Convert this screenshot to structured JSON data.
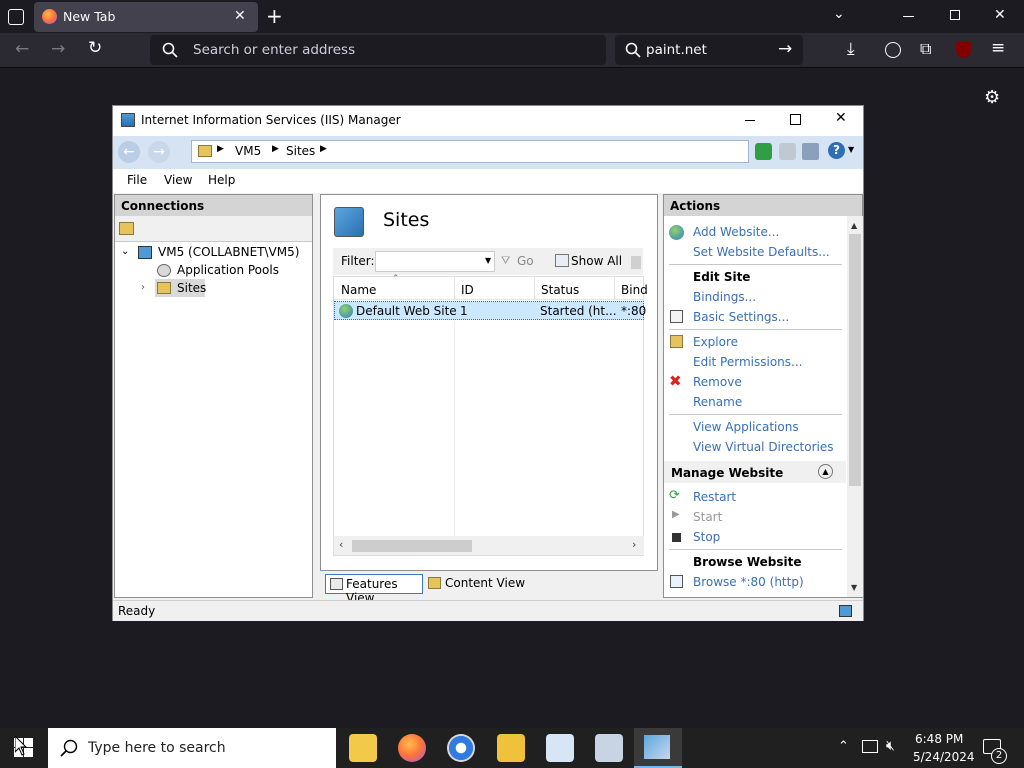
{
  "browser": {
    "tab_title": "New Tab",
    "address_placeholder": "Search or enter address",
    "search_value": "paint.net"
  },
  "iis": {
    "title": "Internet Information Services (IIS) Manager",
    "breadcrumb": [
      "VM5",
      "Sites"
    ],
    "menu": [
      "File",
      "View",
      "Help"
    ],
    "connections": {
      "header": "Connections",
      "tree": [
        {
          "label": "VM5 (COLLABNET\\VM5)"
        },
        {
          "label": "Application Pools"
        },
        {
          "label": "Sites"
        }
      ]
    },
    "sites": {
      "title": "Sites",
      "filter_label": "Filter:",
      "go_label": "Go",
      "show_all_label": "Show All",
      "columns": [
        "Name",
        "ID",
        "Status",
        "Bind"
      ],
      "rows": [
        {
          "name": "Default Web Site",
          "id": "1",
          "status": "Started (ht...",
          "binding": "*:80"
        }
      ],
      "features_view": "Features View",
      "content_view": "Content View"
    },
    "actions": {
      "header": "Actions",
      "add_website": "Add Website...",
      "set_defaults": "Set Website Defaults...",
      "edit_site": "Edit Site",
      "bindings": "Bindings...",
      "basic_settings": "Basic Settings...",
      "explore": "Explore",
      "edit_permissions": "Edit Permissions...",
      "remove": "Remove",
      "rename": "Rename",
      "view_applications": "View Applications",
      "view_virtual_dirs": "View Virtual Directories",
      "manage_website": "Manage Website",
      "restart": "Restart",
      "start": "Start",
      "stop": "Stop",
      "browse_website": "Browse Website",
      "browse_80": "Browse *:80 (http)"
    },
    "status": "Ready"
  },
  "taskbar": {
    "search_placeholder": "Type here to search",
    "time": "6:48 PM",
    "date": "5/24/2024",
    "notification_count": "2"
  },
  "colors": {
    "link_blue": "#3a6fb4",
    "selection": "#cce8ff",
    "addr_band": "#d6e3f3"
  }
}
